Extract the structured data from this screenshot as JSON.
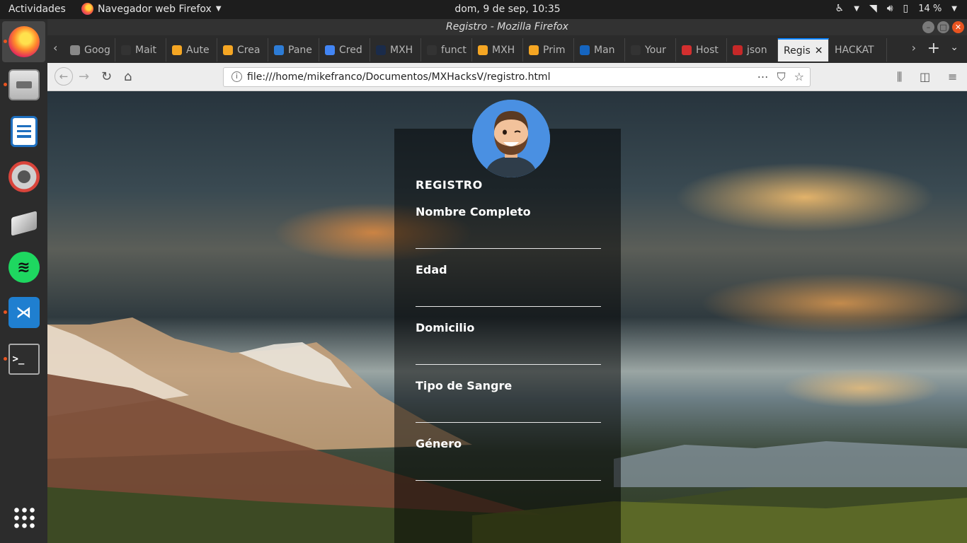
{
  "topbar": {
    "activities": "Actividades",
    "app_menu": "Navegador web Firefox",
    "clock": "dom,  9 de sep, 10:35",
    "battery": "14 %"
  },
  "dock": {
    "items": [
      "firefox",
      "files",
      "libreoffice-writer",
      "system-settings",
      "software-updater",
      "spotify",
      "vscode",
      "terminal",
      "show-applications"
    ]
  },
  "window": {
    "title": "Registro - Mozilla Firefox"
  },
  "tabs": [
    {
      "label": "Goog",
      "fav_color": "#888888"
    },
    {
      "label": "Mait",
      "fav_color": "#333333"
    },
    {
      "label": "Aute",
      "fav_color": "#f5a623"
    },
    {
      "label": "Crea",
      "fav_color": "#f5a623"
    },
    {
      "label": "Pane",
      "fav_color": "#2d7cd6"
    },
    {
      "label": "Cred",
      "fav_color": "#4285f4"
    },
    {
      "label": "MXH",
      "fav_color": "#1a2b4a"
    },
    {
      "label": "funct",
      "fav_color": "#333333"
    },
    {
      "label": "MXH",
      "fav_color": "#f5a623"
    },
    {
      "label": "Prim",
      "fav_color": "#f5a623"
    },
    {
      "label": "Man",
      "fav_color": "#1565c0"
    },
    {
      "label": "Your",
      "fav_color": "#333333"
    },
    {
      "label": "Host",
      "fav_color": "#d32f2f"
    },
    {
      "label": "json",
      "fav_color": "#c62828"
    },
    {
      "label": "Regis",
      "fav_color": "",
      "selected": true
    },
    {
      "label": "HACKAT",
      "fav_color": ""
    }
  ],
  "navbar": {
    "url": "file:///home/mikefranco/Documentos/MXHacksV/registro.html"
  },
  "form": {
    "title": "REGISTRO",
    "fields": [
      {
        "label": "Nombre Completo"
      },
      {
        "label": "Edad"
      },
      {
        "label": "Domicilio"
      },
      {
        "label": "Tipo de Sangre"
      },
      {
        "label": "Género"
      }
    ]
  }
}
